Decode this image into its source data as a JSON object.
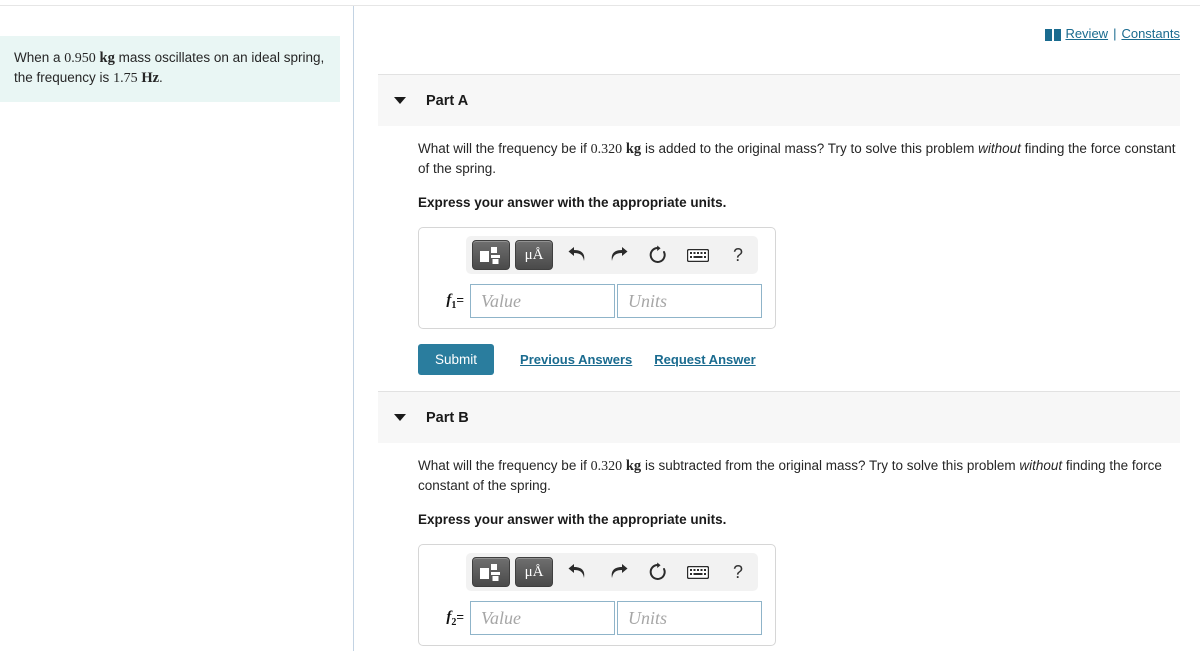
{
  "header": {
    "book_icon": "book-icon",
    "review_label": "Review",
    "separator": "|",
    "constants_label": "Constants"
  },
  "problem": {
    "text_part1": "When a ",
    "mass_value": "0.950",
    "mass_unit": "kg",
    "text_part2": " mass oscillates on an ideal spring, the frequency is ",
    "frequency_value": "1.75",
    "frequency_unit": "Hz",
    "text_part3": "."
  },
  "parts": [
    {
      "id": "part-a",
      "title": "Part A",
      "caret_icon": "caret-down-icon",
      "question_pre": "What will the frequency be if ",
      "question_value": "0.320",
      "question_unit": "kg",
      "question_mid": " is added to the original mass? Try to solve this problem ",
      "question_emphasis": "without",
      "question_post": " finding the force constant of the spring.",
      "instruction": "Express your answer with the appropriate units.",
      "toolbar": {
        "template_icon": "math-template-icon",
        "units_icon": "micro-angstrom-units-icon",
        "undo_icon": "undo-arrow-icon",
        "redo_icon": "redo-arrow-icon",
        "reset_icon": "reset-circular-arrow-icon",
        "keyboard_icon": "keyboard-icon",
        "help_icon": "question-mark-icon",
        "help_glyph": "?"
      },
      "answer": {
        "symbol": "f",
        "subscript": "1",
        "equals": "=",
        "value_placeholder": "Value",
        "units_placeholder": "Units",
        "value_current": "",
        "units_current": ""
      },
      "actions": {
        "submit_label": "Submit",
        "previous_answers_label": "Previous Answers",
        "request_answer_label": "Request Answer"
      }
    },
    {
      "id": "part-b",
      "title": "Part B",
      "caret_icon": "caret-down-icon",
      "question_pre": "What will the frequency be if ",
      "question_value": "0.320",
      "question_unit": "kg",
      "question_mid": " is subtracted from the original mass? Try to solve this problem ",
      "question_emphasis": "without",
      "question_post": " finding the force constant of the spring.",
      "instruction": "Express your answer with the appropriate units.",
      "toolbar": {
        "template_icon": "math-template-icon",
        "units_icon": "micro-angstrom-units-icon",
        "undo_icon": "undo-arrow-icon",
        "redo_icon": "redo-arrow-icon",
        "reset_icon": "reset-circular-arrow-icon",
        "keyboard_icon": "keyboard-icon",
        "help_icon": "question-mark-icon",
        "help_glyph": "?"
      },
      "answer": {
        "symbol": "f",
        "subscript": "2",
        "equals": "=",
        "value_placeholder": "Value",
        "units_placeholder": "Units",
        "value_current": "",
        "units_current": ""
      }
    }
  ],
  "colors": {
    "link": "#1a6b8f",
    "submit": "#2a7d9e",
    "problem_bg": "#e9f6f4",
    "part_header_bg": "#f7f7f7",
    "divider": "#c3d3e3",
    "field_border": "#8fb4c9"
  },
  "units_button_label": "μÅ"
}
